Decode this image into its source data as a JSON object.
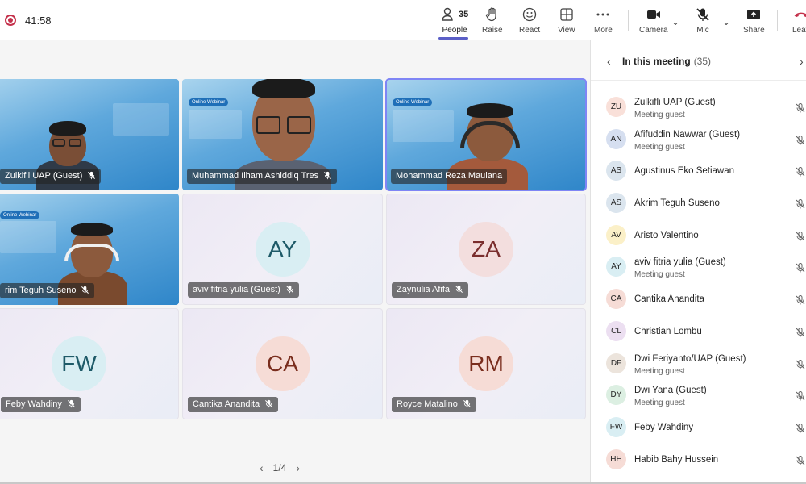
{
  "topbar": {
    "timer": "41:58",
    "people": {
      "label": "People",
      "count": "35"
    },
    "raise": "Raise",
    "react": "React",
    "view": "View",
    "more": "More",
    "camera": "Camera",
    "mic": "Mic",
    "share": "Share",
    "leave": "Leave"
  },
  "tiles": [
    {
      "name": "Zulkifli UAP (Guest)"
    },
    {
      "name": "Muhammad Ilham Ashiddiq Tres"
    },
    {
      "name": "Mohammad Reza Maulana"
    },
    {
      "name": "Akrim Teguh Suseno",
      "shown": "rim Teguh Suseno"
    },
    {
      "name": "aviv fitria yulia (Guest)",
      "initials": "AY"
    },
    {
      "name": "Zaynulia Afifa",
      "initials": "ZA"
    },
    {
      "name": "Feby Wahdiny",
      "initials": "FW"
    },
    {
      "name": "Cantika Anandita",
      "initials": "CA"
    },
    {
      "name": "Royce Matalino",
      "initials": "RM"
    }
  ],
  "slides": {
    "badge": "Online Webinar"
  },
  "pager": {
    "text": "1/4"
  },
  "panel": {
    "title": "In this meeting",
    "count": "(35)",
    "participants": [
      {
        "initials": "ZU",
        "name": "Zulkifli UAP (Guest)",
        "role": "Meeting guest",
        "color": "#f9e0d9"
      },
      {
        "initials": "AN",
        "name": "Afifuddin Nawwar (Guest)",
        "role": "Meeting guest",
        "color": "#d6dff0"
      },
      {
        "initials": "AS",
        "name": "Agustinus Eko Setiawan",
        "role": "",
        "color": "#dbe5ee"
      },
      {
        "initials": "AS",
        "name": "Akrim Teguh Suseno",
        "role": "",
        "color": "#dbe5ee"
      },
      {
        "initials": "AV",
        "name": "Aristo Valentino",
        "role": "",
        "color": "#fbf0c8"
      },
      {
        "initials": "AY",
        "name": "aviv fitria yulia (Guest)",
        "role": "Meeting guest",
        "color": "#d9eef3"
      },
      {
        "initials": "CA",
        "name": "Cantika Anandita",
        "role": "",
        "color": "#f6dcd6"
      },
      {
        "initials": "CL",
        "name": "Christian Lombu",
        "role": "",
        "color": "#ecdff1"
      },
      {
        "initials": "DF",
        "name": "Dwi Feriyanto/UAP (Guest)",
        "role": "Meeting guest",
        "color": "#ece4dc"
      },
      {
        "initials": "DY",
        "name": "Dwi Yana (Guest)",
        "role": "Meeting guest",
        "color": "#dcefe2"
      },
      {
        "initials": "FW",
        "name": "Feby Wahdiny",
        "role": "",
        "color": "#d9eef3"
      },
      {
        "initials": "HH",
        "name": "Habib Bahy Hussein",
        "role": "",
        "color": "#f6dcd6"
      }
    ]
  }
}
